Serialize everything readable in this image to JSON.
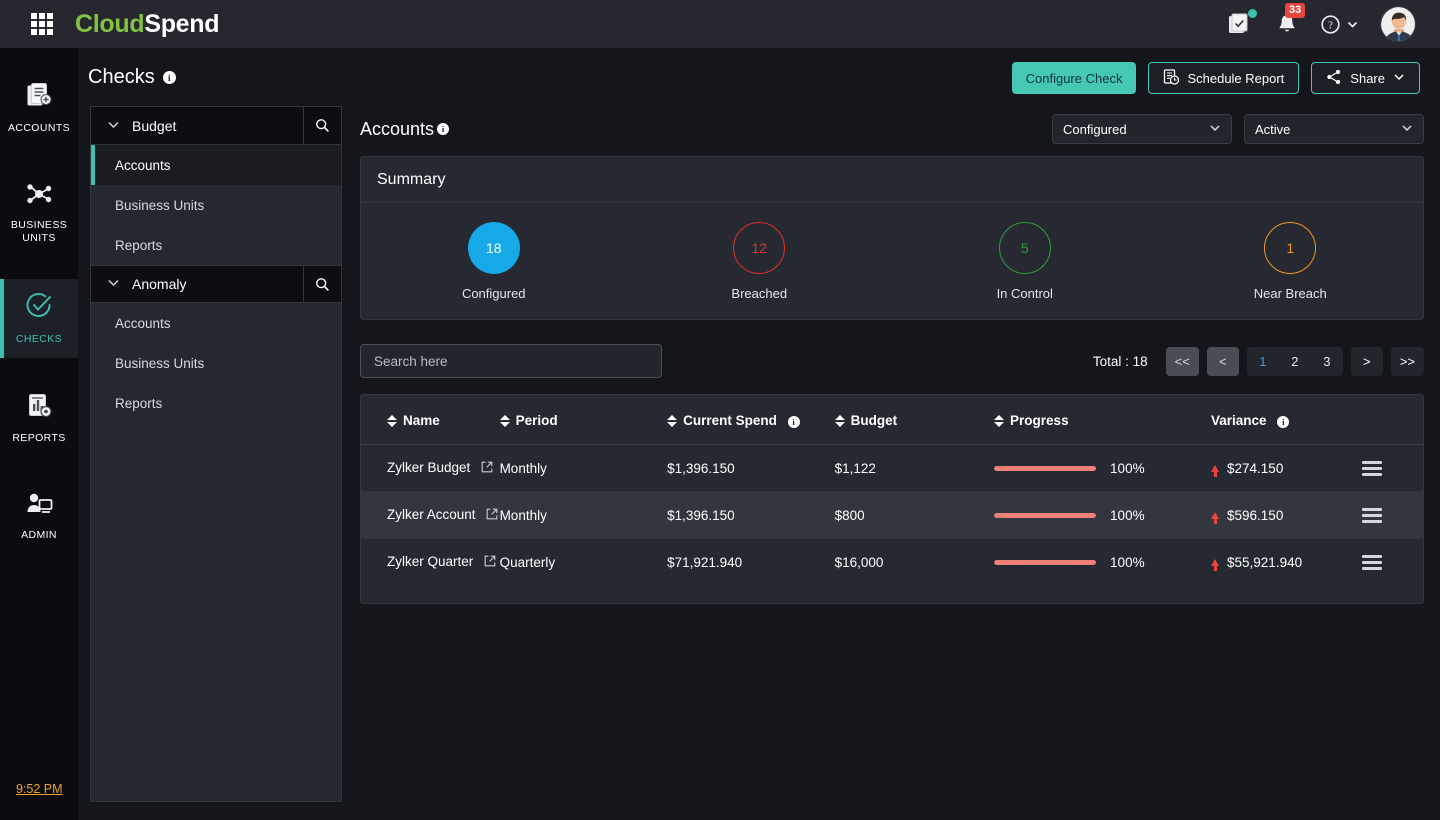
{
  "topbar": {
    "brand_part1": "Cloud",
    "brand_part2": "Spend",
    "brand_color1": "#84c043",
    "grid_icon": "apps-grid-icon",
    "tasks_icon": "tasks-checklist-icon",
    "bell_icon": "notification-bell-icon",
    "notification_count": "33",
    "help_icon": "help-circle-icon",
    "avatar": "user-avatar"
  },
  "rail": {
    "items": [
      {
        "label": "ACCOUNTS",
        "icon": "accounts-icon",
        "active": false
      },
      {
        "label": "BUSINESS\nUNITS",
        "icon": "business-units-icon",
        "active": false
      },
      {
        "label": "CHECKS",
        "icon": "checks-icon",
        "active": true
      },
      {
        "label": "REPORTS",
        "icon": "reports-icon",
        "active": false
      },
      {
        "label": "ADMIN",
        "icon": "admin-icon",
        "active": false
      }
    ],
    "clock": "9:52 PM",
    "clock_color": "#f0a32c",
    "accent": "#3bc1b0"
  },
  "header": {
    "title": "Checks",
    "info_glyph": "i",
    "actions": {
      "configure": "Configure Check",
      "schedule": "Schedule Report",
      "share": "Share"
    }
  },
  "sidebar": {
    "groups": [
      {
        "label": "Budget",
        "items": [
          {
            "label": "Accounts",
            "active": true
          },
          {
            "label": "Business Units",
            "active": false
          },
          {
            "label": "Reports",
            "active": false
          }
        ]
      },
      {
        "label": "Anomaly",
        "items": [
          {
            "label": "Accounts",
            "active": false
          },
          {
            "label": "Business Units",
            "active": false
          },
          {
            "label": "Reports",
            "active": false
          }
        ]
      }
    ]
  },
  "main": {
    "section_title": "Accounts",
    "filters": [
      {
        "value": "Configured"
      },
      {
        "value": "Active"
      }
    ],
    "summary": {
      "title": "Summary",
      "cells": [
        {
          "value": "18",
          "label": "Configured",
          "color": "#16a9e8",
          "filled": true
        },
        {
          "value": "12",
          "label": "Breached",
          "color": "#e03029",
          "filled": false
        },
        {
          "value": "5",
          "label": "In Control",
          "color": "#2e9c3f",
          "filled": false
        },
        {
          "value": "1",
          "label": "Near Breach",
          "color": "#f2961f",
          "filled": false
        }
      ]
    },
    "search_placeholder": "Search here",
    "search_value": "",
    "pagination": {
      "total": "Total : 18",
      "first": "<<",
      "prev": "<",
      "pages": [
        "1",
        "2",
        "3"
      ],
      "current": "1",
      "next": ">",
      "last": ">>"
    },
    "table": {
      "columns": [
        {
          "label": "Name",
          "sortable": true,
          "info": false
        },
        {
          "label": "Period",
          "sortable": true,
          "info": false
        },
        {
          "label": "Current Spend",
          "sortable": true,
          "info": true
        },
        {
          "label": "Budget",
          "sortable": true,
          "info": false
        },
        {
          "label": "Progress",
          "sortable": true,
          "info": false
        },
        {
          "label": "Variance",
          "sortable": false,
          "info": true
        }
      ],
      "rows": [
        {
          "name": "Zylker Budget",
          "period": "Monthly",
          "current_spend": "$1,396.150",
          "budget": "$1,122",
          "progress_pct": "100%",
          "progress_value": 100,
          "variance": "$274.150",
          "variance_direction": "up",
          "highlighted": false
        },
        {
          "name": "Zylker Account",
          "period": "Monthly",
          "current_spend": "$1,396.150",
          "budget": "$800",
          "progress_pct": "100%",
          "progress_value": 100,
          "variance": "$596.150",
          "variance_direction": "up",
          "highlighted": true
        },
        {
          "name": "Zylker Quarter",
          "period": "Quarterly",
          "current_spend": "$71,921.940",
          "budget": "$16,000",
          "progress_pct": "100%",
          "progress_value": 100,
          "variance": "$55,921.940",
          "variance_direction": "up",
          "highlighted": false
        }
      ]
    }
  }
}
